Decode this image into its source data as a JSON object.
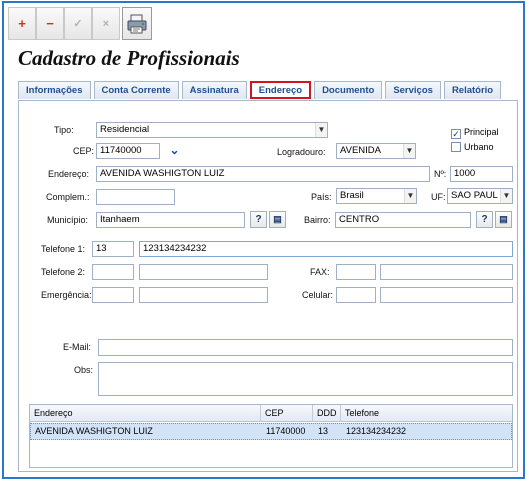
{
  "toolbar": {
    "add_icon": "+",
    "remove_icon": "−",
    "confirm_icon": "✓",
    "cancel_icon": "×",
    "print_icon": "printer-icon"
  },
  "page_title": "Cadastro de Profissionais",
  "tabs": [
    {
      "label": "Informações"
    },
    {
      "label": "Conta Corrente"
    },
    {
      "label": "Assinatura"
    },
    {
      "label": "Endereço"
    },
    {
      "label": "Documento"
    },
    {
      "label": "Serviços"
    },
    {
      "label": "Relatório"
    }
  ],
  "form": {
    "tipo_label": "Tipo:",
    "tipo_value": "Residencial",
    "principal_label": "Principal",
    "principal_checked": true,
    "urbano_label": "Urbano",
    "urbano_checked": false,
    "cep_label": "CEP:",
    "cep_value": "11740000",
    "logradouro_label": "Logradouro:",
    "logradouro_value": "AVENIDA",
    "endereco_label": "Endereço:",
    "endereco_value": "AVENIDA WASHIGTON LUIZ",
    "numero_label": "Nº:",
    "numero_value": "1000",
    "complemento_label": "Complem.:",
    "complemento_value": "",
    "pais_label": "País:",
    "pais_value": "Brasil",
    "uf_label": "UF:",
    "uf_value": "SAO PAUL",
    "municipio_label": "Município:",
    "municipio_value": "Itanhaem",
    "bairro_label": "Bairro:",
    "bairro_value": "CENTRO",
    "help_glyph": "?",
    "telefone1_label": "Telefone 1:",
    "telefone1_ddd": "13",
    "telefone1_number": "123134234232",
    "telefone2_label": "Telefone 2:",
    "emergencia_label": "Emergência:",
    "fax_label": "FAX:",
    "celular_label": "Celular:",
    "email_label": "E-Mail:",
    "obs_label": "Obs:"
  },
  "grid": {
    "columns": [
      "Endereço",
      "CEP",
      "DDD",
      "Telefone"
    ],
    "rows": [
      {
        "endereco": "AVENIDA WASHIGTON LUIZ",
        "cep": "11740000",
        "ddd": "13",
        "telefone": "123134234232"
      }
    ]
  }
}
